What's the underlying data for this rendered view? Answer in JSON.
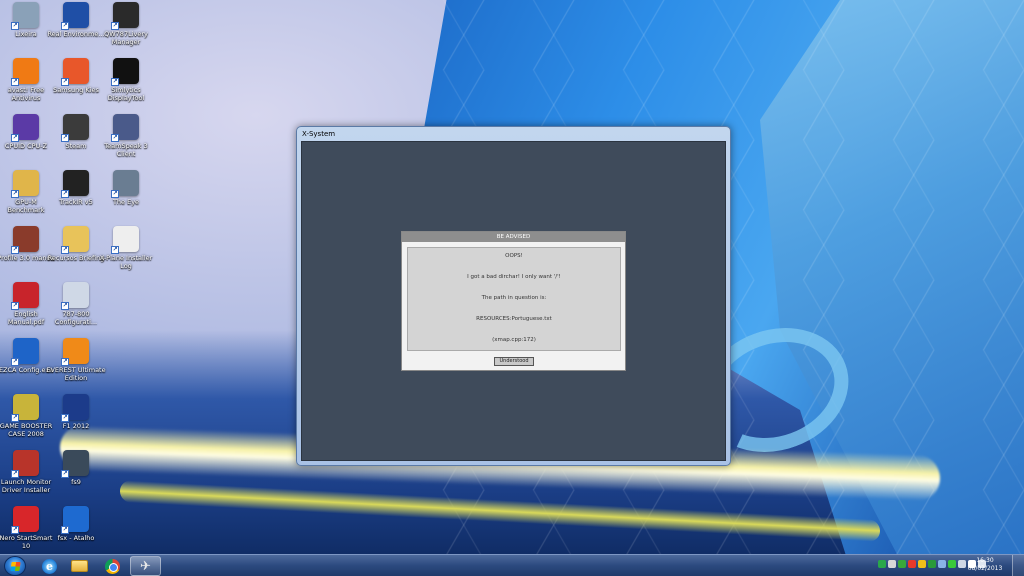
{
  "desktop": {
    "icons": [
      {
        "label": "Lixeira",
        "icon": "recycle-bin-icon",
        "color": "#8aa1b8"
      },
      {
        "label": "Real Environme...",
        "icon": "rex-icon",
        "color": "#1f4fa6"
      },
      {
        "label": "QW787Livery Manager",
        "icon": "qw787-icon",
        "color": "#2a2a2a"
      },
      {
        "label": "avast! Free Antivirus",
        "icon": "avast-icon",
        "color": "#f07a14"
      },
      {
        "label": "Samsung Kies",
        "icon": "samsung-kies-icon",
        "color": "#e8572a"
      },
      {
        "label": "Simlytics DisplayTool",
        "icon": "simlytics-icon",
        "color": "#111111"
      },
      {
        "label": "CPUID CPU-Z",
        "icon": "cpu-z-icon",
        "color": "#5b3aa6"
      },
      {
        "label": "Steam",
        "icon": "steam-icon",
        "color": "#3b3b3b"
      },
      {
        "label": "TeamSpeak 3 Client",
        "icon": "teamspeak-icon",
        "color": "#4a5a8a"
      },
      {
        "label": "GPU-M Benchmark",
        "icon": "gpu-m-icon",
        "color": "#e0b54a"
      },
      {
        "label": "TrackIR v5",
        "icon": "trackir-icon",
        "color": "#222222"
      },
      {
        "label": "The Eye",
        "icon": "globe-icon",
        "color": "#6a7d92"
      },
      {
        "label": "Profile 3.0 manda",
        "icon": "profile-photo-icon",
        "color": "#8a3b2b"
      },
      {
        "label": "Recursos Briefing",
        "icon": "folder-icon",
        "color": "#e8c35a"
      },
      {
        "label": "X-Plane Installer Log",
        "icon": "document-icon",
        "color": "#eeeeee"
      },
      {
        "label": "English Manual.pdf",
        "icon": "pdf-icon",
        "color": "#c8242b"
      },
      {
        "label": "787-800 Configurati...",
        "icon": "airplane-icon",
        "color": "#cfd8e6"
      },
      {
        "label": "EZCA Config.exe",
        "icon": "ezca-icon",
        "color": "#1e64c8"
      },
      {
        "label": "EVEREST Ultimate Edition",
        "icon": "everest-icon",
        "color": "#f08a18"
      },
      {
        "label": "GAME BOOSTER CASE 2008",
        "icon": "game-booster-icon",
        "color": "#c8b43a"
      },
      {
        "label": "F1 2012",
        "icon": "f1-2012-icon",
        "color": "#1c3b8a"
      },
      {
        "label": "Launch Monitor Driver Installer",
        "icon": "monitor-driver-icon",
        "color": "#b8342a"
      },
      {
        "label": "fs9",
        "icon": "airplane-icon",
        "color": "#3a4a5a"
      },
      {
        "label": "Nero StartSmart 10",
        "icon": "nero-icon",
        "color": "#d8262a"
      },
      {
        "label": "fsx - Atalho",
        "icon": "fsx-icon",
        "color": "#1e6ad0"
      }
    ]
  },
  "window": {
    "title": "X-System"
  },
  "dialog": {
    "title": "BE ADVISED",
    "lines": [
      "OOPS!",
      "I got a bad dirchar! I only want '/'!",
      "The path in question is:",
      "RESOURCES:Portuguese.txt",
      "(xmap.cpp:172)"
    ],
    "button_label": "Understood"
  },
  "taskbar": {
    "clock_time": "16:30",
    "clock_date": "08/02/2013",
    "tray_colors": [
      "#2aa84a",
      "#d8d8d8",
      "#3aa83a",
      "#e83a2a",
      "#f0c01a",
      "#2a9a3a",
      "#8ab4e8",
      "#3ac83a",
      "#cfd8e6",
      "#ffffff",
      "#dfe6f0"
    ]
  }
}
